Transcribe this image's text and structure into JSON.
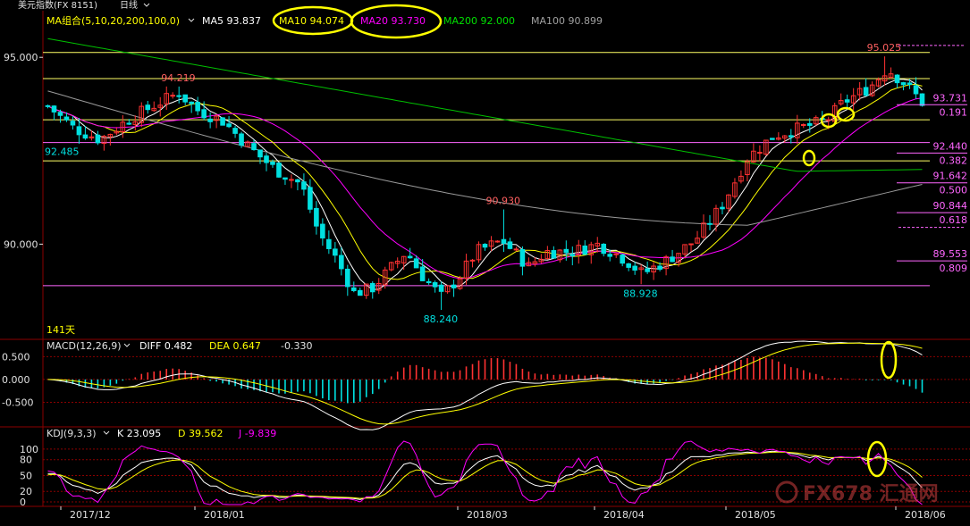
{
  "window": {
    "title": "美元指数(FX 8151)",
    "period": "日线"
  },
  "main_panel": {
    "indicator_label": "MA组合(5,10,20,200,100,0)",
    "ma_values": [
      {
        "label": "MA5 93.837",
        "color": "#ffffff"
      },
      {
        "label": "MA10 94.074",
        "color": "#ffff00"
      },
      {
        "label": "MA20 93.730",
        "color": "#ff00ff"
      },
      {
        "label": "MA200 92.000",
        "color": "#00e000"
      },
      {
        "label": "MA100 90.899",
        "color": "#a0a0a0"
      }
    ],
    "bar_count": "141天"
  },
  "macd_panel": {
    "label": "MACD(12,26,9)",
    "diff": "DIFF 0.482",
    "dea": "DEA 0.647",
    "macd": "-0.330"
  },
  "kdj_panel": {
    "label": "KDJ(9,3,3)",
    "k": "K 23.095",
    "d": "D 39.562",
    "j": "J -9.839"
  },
  "watermark": "FX678 汇通网",
  "colors": {
    "up": "#ff3232",
    "down": "#00e0e0",
    "ma5": "#ffffff",
    "ma10": "#ffff00",
    "ma20": "#ff00ff",
    "ma200": "#00c000",
    "ma100": "#9a9a9a",
    "grid": "#8b0000",
    "annotation": "#ffff00"
  },
  "chart_data": {
    "type": "candlestick",
    "x_tick_labels": [
      "2017/12",
      "2018/01",
      "2018/03",
      "2018/04",
      "2018/05",
      "2018/06"
    ],
    "price_axis": {
      "ticks": [
        95.0,
        90.0
      ],
      "tick_labels": [
        "95.000",
        "90.000"
      ],
      "range": [
        87.5,
        96.2
      ]
    },
    "price_labels": [
      {
        "text": "94.219",
        "value": 94.219
      },
      {
        "text": "92.485",
        "value": 92.485
      },
      {
        "text": "90.930",
        "value": 90.93
      },
      {
        "text": "88.240",
        "value": 88.24
      },
      {
        "text": "88.928",
        "value": 88.928
      },
      {
        "text": "95.025",
        "value": 95.025
      }
    ],
    "horizontal_levels": [
      {
        "value": 95.13,
        "color": "#ffff66"
      },
      {
        "value": 94.43,
        "color": "#ffff66"
      },
      {
        "value": 93.33,
        "color": "#ffff66"
      },
      {
        "value": 92.72,
        "color": "#ff66ff"
      },
      {
        "value": 92.23,
        "color": "#ffff66"
      },
      {
        "value": 88.89,
        "color": "#ff66ff"
      }
    ],
    "fibonacci_levels": [
      {
        "price": "93.731",
        "ratio": "0.191"
      },
      {
        "price": "92.440",
        "ratio": "0.382"
      },
      {
        "price": "91.642",
        "ratio": "0.500"
      },
      {
        "price": "90.844",
        "ratio": "0.618"
      },
      {
        "price": "89.553",
        "ratio": "0.809"
      }
    ],
    "macd_axis": {
      "tick_labels": [
        "0.500",
        "0.000",
        "-0.500"
      ],
      "range": [
        -1.0,
        0.8
      ]
    },
    "kdj_axis": {
      "tick_labels": [
        "100",
        "80",
        "50",
        "20",
        "0"
      ],
      "range": [
        -5,
        115
      ]
    }
  }
}
